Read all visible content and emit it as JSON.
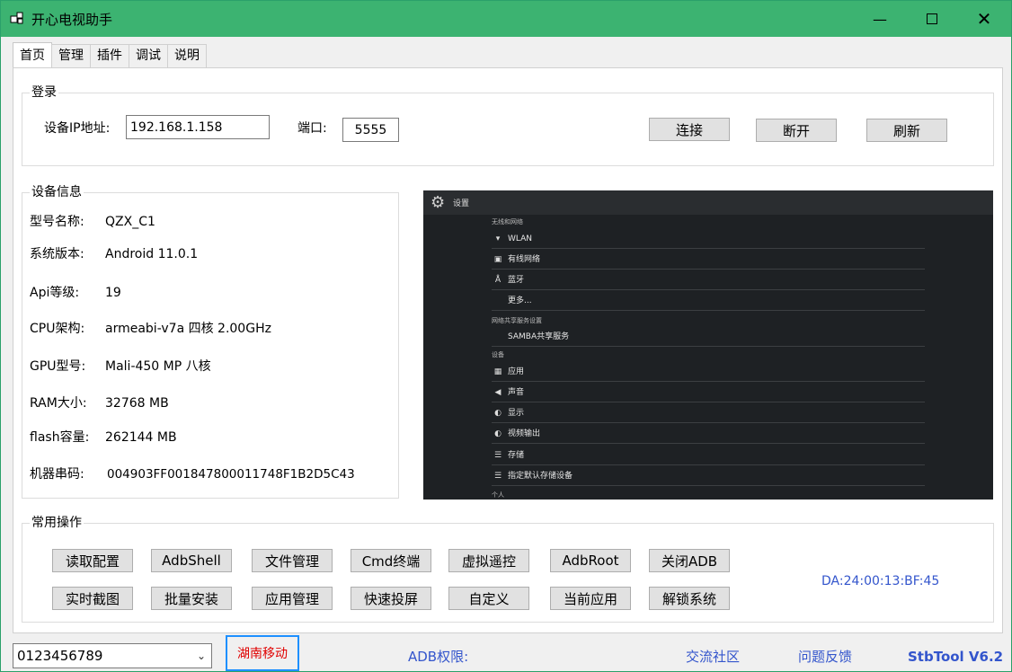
{
  "window": {
    "title": "开心电视助手",
    "app_icon": "app-windows-icon",
    "controls": [
      "minimize-icon",
      "maximize-icon",
      "close-icon"
    ],
    "titlebar_color": "#3cb371"
  },
  "tabs": [
    {
      "label": "首页",
      "active": true
    },
    {
      "label": "管理"
    },
    {
      "label": "插件"
    },
    {
      "label": "调试"
    },
    {
      "label": "说明"
    }
  ],
  "login": {
    "group_title": "登录",
    "ip_label": "设备IP地址:",
    "ip_value": "192.168.1.158",
    "port_label": "端口:",
    "port_value": "5555",
    "connect": "连接",
    "disconnect": "断开",
    "refresh": "刷新"
  },
  "device_info": {
    "group_title": "设备信息",
    "rows": [
      {
        "label": "型号名称:",
        "value": "QZX_C1"
      },
      {
        "label": "系统版本:",
        "value": "Android 11.0.1"
      },
      {
        "label": "Api等级:",
        "value": "19"
      },
      {
        "label": "CPU架构:",
        "value": "armeabi-v7a 四核 2.00GHz"
      },
      {
        "label": "GPU型号:",
        "value": "Mali-450 MP 八核"
      },
      {
        "label": "RAM大小:",
        "value": "32768 MB"
      },
      {
        "label": "flash容量:",
        "value": "262144 MB"
      },
      {
        "label": "机器串码:",
        "value": "004903FF001847800011748F1B2D5C43"
      }
    ]
  },
  "screenshot": {
    "title": "设置",
    "sections": [
      {
        "label": "无线和网络",
        "type": "section"
      },
      {
        "label": "WLAN",
        "icon": "wifi-icon",
        "type": "item"
      },
      {
        "label": "有线网络",
        "icon": "ethernet-icon",
        "type": "item"
      },
      {
        "label": "蓝牙",
        "icon": "bluetooth-icon",
        "type": "item"
      },
      {
        "label": "更多...",
        "icon": "",
        "type": "item"
      },
      {
        "label": "网络共享服务设置",
        "type": "section"
      },
      {
        "label": "SAMBA共享服务",
        "icon": "",
        "type": "item"
      },
      {
        "label": "设备",
        "type": "section"
      },
      {
        "label": "应用",
        "icon": "image-icon",
        "type": "item"
      },
      {
        "label": "声音",
        "icon": "speaker-icon",
        "type": "item"
      },
      {
        "label": "显示",
        "icon": "brightness-icon",
        "type": "item"
      },
      {
        "label": "视频输出",
        "icon": "brightness-icon",
        "type": "item"
      },
      {
        "label": "存储",
        "icon": "list-icon",
        "type": "item"
      },
      {
        "label": "指定默认存储设备",
        "icon": "list-icon",
        "type": "item"
      },
      {
        "label": "个人",
        "type": "section"
      }
    ]
  },
  "operations": {
    "group_title": "常用操作",
    "row1": [
      "读取配置",
      "AdbShell",
      "文件管理",
      "Cmd终端",
      "虚拟遥控",
      "AdbRoot",
      "关闭ADB"
    ],
    "row2": [
      "实时截图",
      "批量安装",
      "应用管理",
      "快速投屏",
      "自定义",
      "当前应用",
      "解锁系统"
    ],
    "mac": "DA:24:00:13:BF:45"
  },
  "statusbar": {
    "device_select": "0123456789",
    "carrier": "湖南移动",
    "adb_label": "ADB权限:",
    "community": "交流社区",
    "feedback": "问题反馈",
    "version": "StbTool V6.2",
    "carrier_color": "#e00000",
    "link_color": "#3355cc"
  }
}
